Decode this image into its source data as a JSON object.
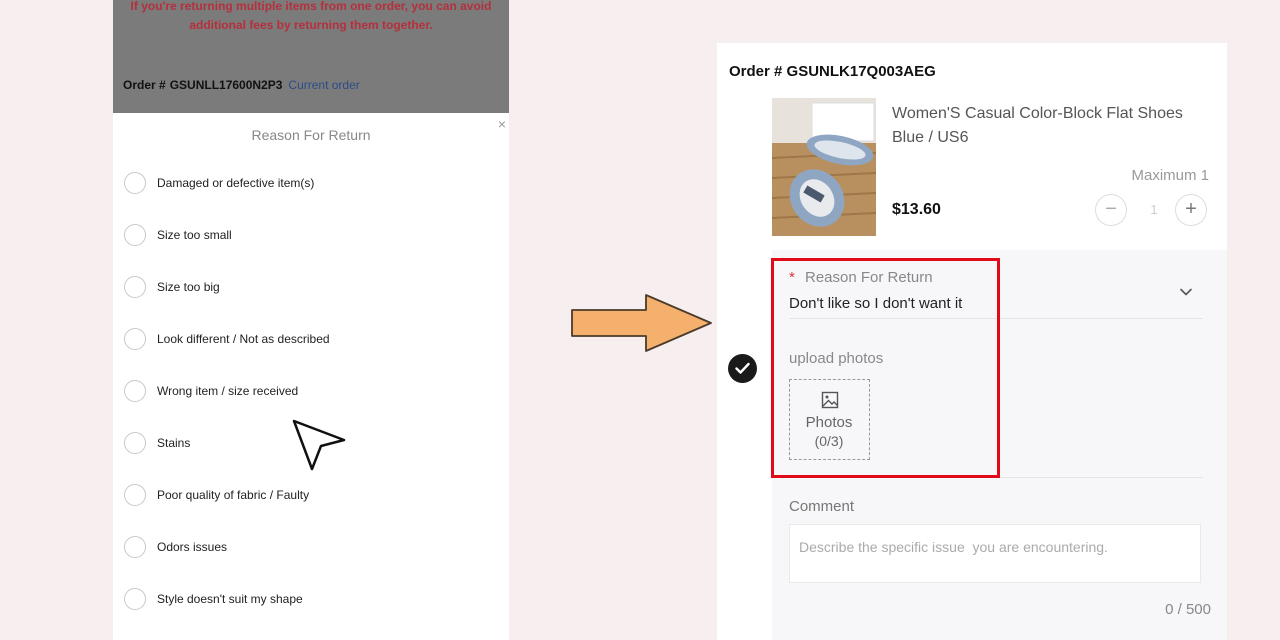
{
  "left": {
    "notice_line1": "If you're returning multiple items from one order, you can avoid",
    "notice_line2": "additional fees by returning them together.",
    "order_label": "Order #",
    "order_number": "GSUNLL17600N2P3",
    "current_order": "Current order",
    "sheet_title": "Reason For Return",
    "close_glyph": "×",
    "reasons": [
      "Damaged or defective item(s)",
      "Size too small",
      "Size too big",
      "Look different / Not as described",
      "Wrong item / size received",
      "Stains",
      "Poor quality of fabric / Faulty",
      "Odors issues",
      "Style doesn't suit my shape"
    ]
  },
  "arrow": {
    "fill": "#f5b06d",
    "stroke": "#4a3b2a"
  },
  "right": {
    "order_label": "Order #",
    "order_number": "GSUNLK17Q003AEG",
    "product_name_line1": "Women'S Casual Color-Block Flat Shoes",
    "product_name_line2": "Blue / US6",
    "max_label": "Maximum 1",
    "price": "$13.60",
    "quantity": "1",
    "minus_glyph": "−",
    "plus_glyph": "+",
    "reason_required": "*",
    "reason_label": "Reason For Return",
    "reason_value": "Don't like so I don't want it",
    "upload_label": "upload photos",
    "photos_label": "Photos",
    "photos_count": "(0/3)",
    "comment_label": "Comment",
    "comment_placeholder": "Describe the specific issue  you are encountering.",
    "char_count": "0 / 500"
  },
  "colors": {
    "highlight": "#e00b1a",
    "notice_text": "#b5303c",
    "link": "#2c4c86"
  },
  "icons": [
    "close-icon",
    "radio-icon",
    "cursor-icon",
    "arrow-icon",
    "chevron-down-icon",
    "image-icon",
    "check-icon"
  ]
}
